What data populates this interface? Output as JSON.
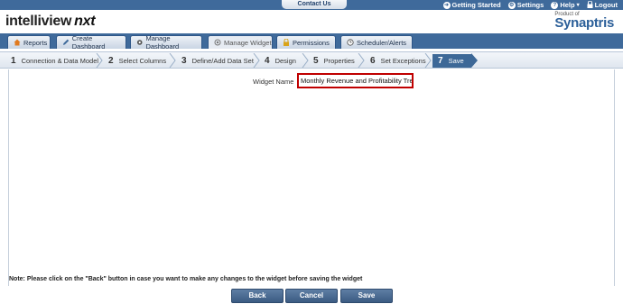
{
  "topbar": {
    "contact": "Contact Us",
    "links": [
      {
        "label": "Getting Started",
        "icon": "getting-started-icon"
      },
      {
        "label": "Settings",
        "icon": "settings-icon"
      },
      {
        "label": "Help",
        "icon": "help-icon"
      },
      {
        "label": "Logout",
        "icon": "lock-icon"
      }
    ]
  },
  "header": {
    "logo_main": "intelliview",
    "logo_nxt": "nxt",
    "brand_small": "Product of",
    "brand_name": "Synaptris"
  },
  "tabs": [
    {
      "label": "Reports"
    },
    {
      "label": "Create Dashboard"
    },
    {
      "label": "Manage Dashboard"
    },
    {
      "label": "Manage Widget"
    },
    {
      "label": "Permissions"
    },
    {
      "label": "Scheduler/Alerts"
    }
  ],
  "steps": [
    {
      "num": "1",
      "label": "Connection & Data Model"
    },
    {
      "num": "2",
      "label": "Select Columns"
    },
    {
      "num": "3",
      "label": "Define/Add Data Set"
    },
    {
      "num": "4",
      "label": "Design"
    },
    {
      "num": "5",
      "label": "Properties"
    },
    {
      "num": "6",
      "label": "Set Exceptions"
    },
    {
      "num": "7",
      "label": "Save"
    }
  ],
  "form": {
    "widget_name_label": "Widget Name",
    "widget_name_value": "Monthly Revenue and Profitability Trend"
  },
  "note": "Note: Please click on the \"Back\" button in case you want to make any changes to the widget before saving the widget",
  "buttons": {
    "back": "Back",
    "cancel": "Cancel",
    "save": "Save"
  },
  "colors": {
    "primary_blue": "#3f6a9b",
    "highlight_red": "#c00000"
  }
}
